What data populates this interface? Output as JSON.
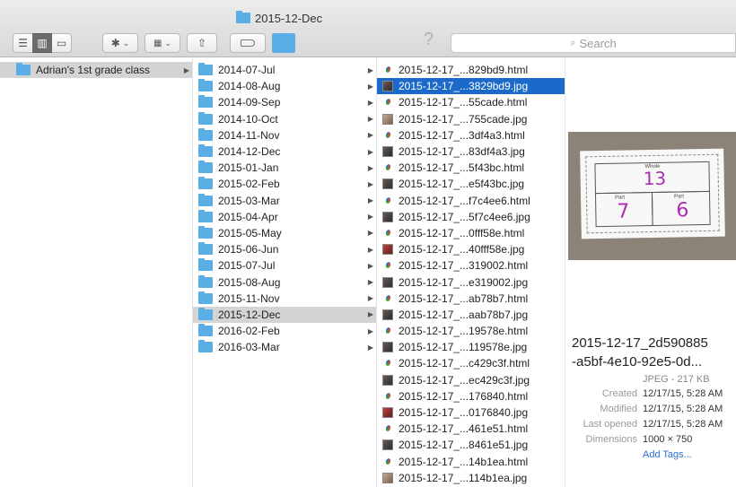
{
  "window": {
    "title": "2015-12-Dec"
  },
  "toolbar": {
    "search_placeholder": "Search",
    "help_glyph": "?",
    "gear_glyph": "✱",
    "share_glyph": "⇧",
    "chevron": "⌄"
  },
  "col1": {
    "items": [
      {
        "label": "Adrian's 1st grade class"
      }
    ]
  },
  "col2": {
    "items": [
      {
        "label": "2014-07-Jul"
      },
      {
        "label": "2014-08-Aug"
      },
      {
        "label": "2014-09-Sep"
      },
      {
        "label": "2014-10-Oct"
      },
      {
        "label": "2014-11-Nov"
      },
      {
        "label": "2014-12-Dec"
      },
      {
        "label": "2015-01-Jan"
      },
      {
        "label": "2015-02-Feb"
      },
      {
        "label": "2015-03-Mar"
      },
      {
        "label": "2015-04-Apr"
      },
      {
        "label": "2015-05-May"
      },
      {
        "label": "2015-06-Jun"
      },
      {
        "label": "2015-07-Jul"
      },
      {
        "label": "2015-08-Aug"
      },
      {
        "label": "2015-11-Nov"
      },
      {
        "label": "2015-12-Dec"
      },
      {
        "label": "2016-02-Feb"
      },
      {
        "label": "2016-03-Mar"
      }
    ]
  },
  "col3": {
    "items": [
      {
        "label": "2015-12-17_...829bd9.html",
        "kind": "html"
      },
      {
        "label": "2015-12-17_...3829bd9.jpg",
        "kind": "jpg"
      },
      {
        "label": "2015-12-17_...55cade.html",
        "kind": "html"
      },
      {
        "label": "2015-12-17_...755cade.jpg",
        "kind": "jpg"
      },
      {
        "label": "2015-12-17_...3df4a3.html",
        "kind": "html"
      },
      {
        "label": "2015-12-17_...83df4a3.jpg",
        "kind": "jpg"
      },
      {
        "label": "2015-12-17_...5f43bc.html",
        "kind": "html"
      },
      {
        "label": "2015-12-17_...e5f43bc.jpg",
        "kind": "jpg"
      },
      {
        "label": "2015-12-17_...f7c4ee6.html",
        "kind": "html"
      },
      {
        "label": "2015-12-17_...5f7c4ee6.jpg",
        "kind": "jpg"
      },
      {
        "label": "2015-12-17_...0fff58e.html",
        "kind": "html"
      },
      {
        "label": "2015-12-17_...40fff58e.jpg",
        "kind": "jpg"
      },
      {
        "label": "2015-12-17_...319002.html",
        "kind": "html"
      },
      {
        "label": "2015-12-17_...e319002.jpg",
        "kind": "jpg"
      },
      {
        "label": "2015-12-17_...ab78b7.html",
        "kind": "html"
      },
      {
        "label": "2015-12-17_...aab78b7.jpg",
        "kind": "jpg"
      },
      {
        "label": "2015-12-17_...19578e.html",
        "kind": "html"
      },
      {
        "label": "2015-12-17_...119578e.jpg",
        "kind": "jpg"
      },
      {
        "label": "2015-12-17_...c429c3f.html",
        "kind": "html"
      },
      {
        "label": "2015-12-17_...ec429c3f.jpg",
        "kind": "jpg"
      },
      {
        "label": "2015-12-17_...176840.html",
        "kind": "html"
      },
      {
        "label": "2015-12-17_...0176840.jpg",
        "kind": "jpg"
      },
      {
        "label": "2015-12-17_...461e51.html",
        "kind": "html"
      },
      {
        "label": "2015-12-17_...8461e51.jpg",
        "kind": "jpg"
      },
      {
        "label": "2015-12-17_...14b1ea.html",
        "kind": "html"
      },
      {
        "label": "2015-12-17_...114b1ea.jpg",
        "kind": "jpg"
      }
    ]
  },
  "preview": {
    "name_line1": "2015-12-17_2d590885",
    "name_line2": "-a5bf-4e10-92e5-0d...",
    "kind_size": "JPEG - 217 KB",
    "image_text": {
      "whole": "Whole",
      "part": "Part",
      "whole_value": "13",
      "part1_value": "7",
      "part2_value": "6"
    },
    "meta": [
      {
        "key": "Created",
        "value": "12/17/15, 5:28 AM"
      },
      {
        "key": "Modified",
        "value": "12/17/15, 5:28 AM"
      },
      {
        "key": "Last opened",
        "value": "12/17/15, 5:28 AM"
      },
      {
        "key": "Dimensions",
        "value": "1000 × 750"
      }
    ],
    "add_tags": "Add Tags..."
  },
  "colors": {
    "selection": "#1b6ac9",
    "folder": "#5aaee6",
    "path_highlight": "#d4d4d4",
    "handwriting": "#b02cb8"
  }
}
